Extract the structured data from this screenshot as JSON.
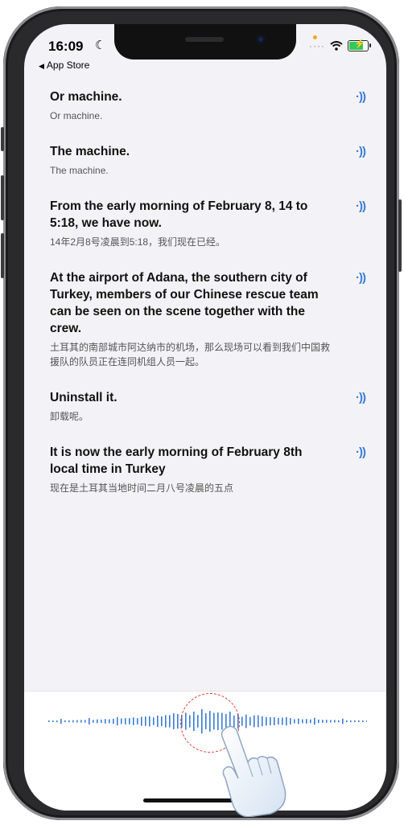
{
  "status_bar": {
    "time": "16:09",
    "back_label": "App Store"
  },
  "transcript": [
    {
      "en": "Or machine.",
      "zh": "Or machine."
    },
    {
      "en": "The machine.",
      "zh": "The machine."
    },
    {
      "en": "From the early morning of February 8, 14 to 5:18, we have now.",
      "zh": "14年2月8号凌晨到5:18，我们现在已经。"
    },
    {
      "en": "At the airport of Adana, the southern city of Turkey, members of our Chinese rescue team can be seen on the scene together with the crew.",
      "zh": "土耳其的南部城市阿达纳市的机场，那么现场可以看到我们中国救援队的队员正在连同机组人员一起。"
    },
    {
      "en": "Uninstall it.",
      "zh": "卸载呢。"
    },
    {
      "en": "It is now the early morning of February 8th local time in Turkey",
      "zh": "现在是土耳其当地时间二月八号凌晨的五点"
    }
  ],
  "icons": {
    "speak": "speaker-wave-icon",
    "moon": "moon-icon",
    "wifi": "wifi-icon",
    "battery": "battery-charging-icon",
    "mic": "voice-waveform-icon"
  },
  "colors": {
    "accent": "#3a7bd5",
    "highlight_ring": "#e0392f",
    "battery": "#34c759"
  }
}
